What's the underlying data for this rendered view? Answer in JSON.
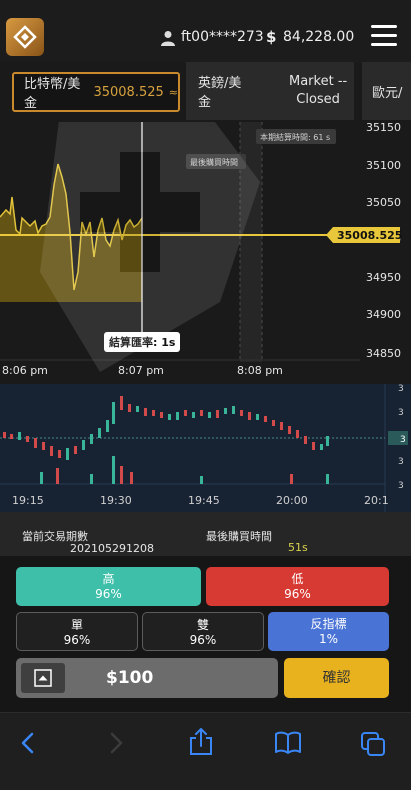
{
  "header": {
    "user_id": "ft00****273",
    "currency_symbol": "$",
    "balance": "84,228.00"
  },
  "tabs": [
    {
      "label": "比特幣/美金",
      "price": "35008.525",
      "chevron": "≈"
    },
    {
      "label": "英鎊/美金",
      "status": "Market --\nClosed"
    },
    {
      "label": "歐元/"
    }
  ],
  "chart": {
    "y_ticks": [
      "35150",
      "35100",
      "35050",
      "35000",
      "34950",
      "34900",
      "34850"
    ],
    "x_ticks": [
      "8:06 pm",
      "8:07 pm",
      "8:08 pm"
    ],
    "current_price": "35008.525",
    "settle_tag": "本期結算時間: 61 s",
    "last_buy_tag": "最後購買時間",
    "settle_rate": "結算匯率: 1s",
    "accent": "#e8c83a"
  },
  "mini_chart": {
    "x_ticks": [
      "19:15",
      "19:30",
      "19:45",
      "20:00",
      "20:1"
    ],
    "y_tick": "3"
  },
  "info": {
    "period_label": "當前交易期數",
    "period_value": "202105291208",
    "last_buy_label": "最後購買時間",
    "countdown": "51s"
  },
  "buttons": {
    "high": {
      "label": "高",
      "pct": "96%"
    },
    "low": {
      "label": "低",
      "pct": "96%"
    },
    "odd": {
      "label": "單",
      "pct": "96%"
    },
    "even": {
      "label": "雙",
      "pct": "96%"
    },
    "reverse": {
      "label": "反指標",
      "pct": "1%"
    },
    "confirm": "確認"
  },
  "amount": "$100",
  "colors": {
    "high": "#3dbfa9",
    "low": "#d63a33",
    "reverse": "#4a73d6",
    "confirm": "#e8b21e",
    "price": "#d6a13e"
  }
}
